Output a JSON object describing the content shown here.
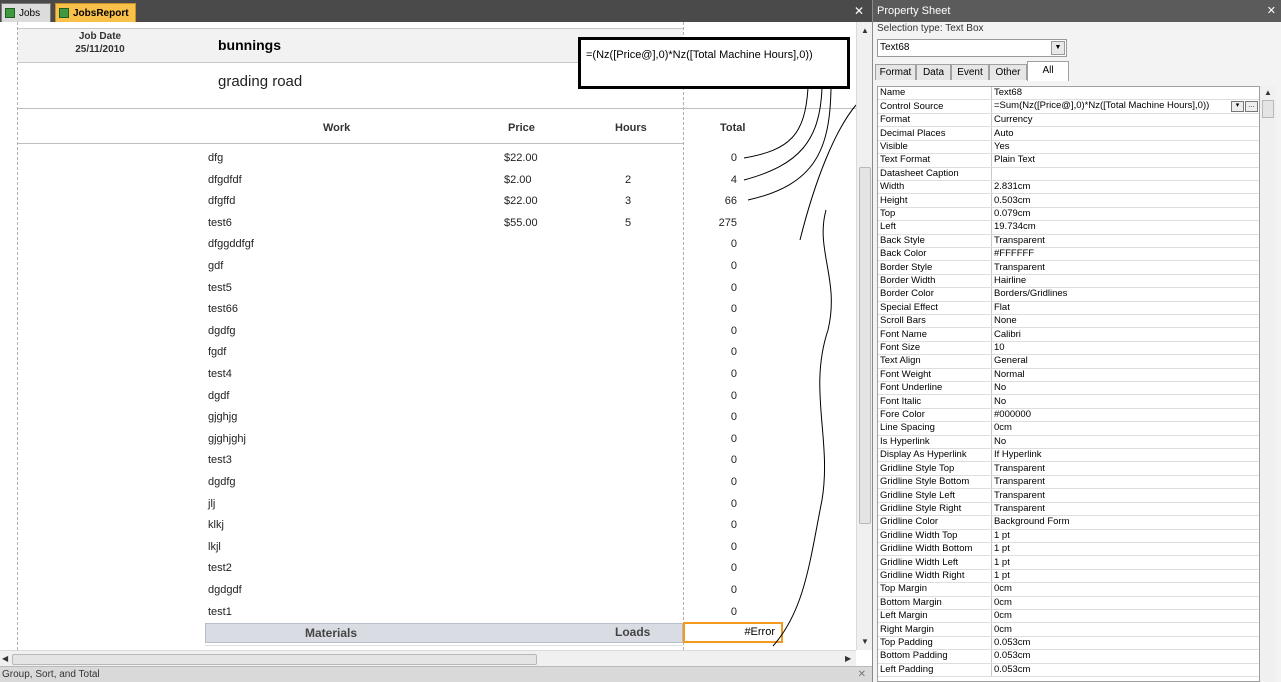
{
  "tabs": {
    "jobs": "Jobs",
    "jobsreport": "JobsReport"
  },
  "report": {
    "job_date_label": "Job Date",
    "job_date_value": "25/11/2010",
    "customer": "bunnings",
    "job_name": "grading road",
    "formula_callout": "=(Nz([Price@],0)*Nz([Total Machine Hours],0))",
    "columns": {
      "work": "Work",
      "price": "Price",
      "hours": "Hours",
      "total": "Total"
    },
    "rows": [
      {
        "work": "dfg",
        "price": "$22.00",
        "hours": "",
        "total": "0"
      },
      {
        "work": "dfgdfdf",
        "price": "$2.00",
        "hours": "2",
        "total": "4"
      },
      {
        "work": "dfgffd",
        "price": "$22.00",
        "hours": "3",
        "total": "66"
      },
      {
        "work": "test6",
        "price": "$55.00",
        "hours": "5",
        "total": "275"
      },
      {
        "work": "dfggddfgf",
        "price": "",
        "hours": "",
        "total": "0"
      },
      {
        "work": "gdf",
        "price": "",
        "hours": "",
        "total": "0"
      },
      {
        "work": "test5",
        "price": "",
        "hours": "",
        "total": "0"
      },
      {
        "work": "test66",
        "price": "",
        "hours": "",
        "total": "0"
      },
      {
        "work": "dgdfg",
        "price": "",
        "hours": "",
        "total": "0"
      },
      {
        "work": "fgdf",
        "price": "",
        "hours": "",
        "total": "0"
      },
      {
        "work": "test4",
        "price": "",
        "hours": "",
        "total": "0"
      },
      {
        "work": "dgdf",
        "price": "",
        "hours": "",
        "total": "0"
      },
      {
        "work": "gjghjg",
        "price": "",
        "hours": "",
        "total": "0"
      },
      {
        "work": "gjghjghj",
        "price": "",
        "hours": "",
        "total": "0"
      },
      {
        "work": "test3",
        "price": "",
        "hours": "",
        "total": "0"
      },
      {
        "work": "dgdfg",
        "price": "",
        "hours": "",
        "total": "0"
      },
      {
        "work": "jlj",
        "price": "",
        "hours": "",
        "total": "0"
      },
      {
        "work": "klkj",
        "price": "",
        "hours": "",
        "total": "0"
      },
      {
        "work": "lkjl",
        "price": "",
        "hours": "",
        "total": "0"
      },
      {
        "work": "test2",
        "price": "",
        "hours": "",
        "total": "0"
      },
      {
        "work": "dgdgdf",
        "price": "",
        "hours": "",
        "total": "0"
      },
      {
        "work": "test1",
        "price": "",
        "hours": "",
        "total": "0"
      }
    ],
    "materials_label": "Materials",
    "loads_label": "Loads",
    "error_value": "#Error"
  },
  "bottom_bar": {
    "label": "Group, Sort, and Total"
  },
  "property_sheet": {
    "title": "Property Sheet",
    "selection_type": "Selection type:  Text Box",
    "selected_control": "Text68",
    "tabs": [
      "Format",
      "Data",
      "Event",
      "Other",
      "All"
    ],
    "active_tab": "All",
    "properties": [
      {
        "name": "Name",
        "value": "Text68"
      },
      {
        "name": "Control Source",
        "value": "=Sum(Nz([Price@],0)*Nz([Total Machine Hours],0))"
      },
      {
        "name": "Format",
        "value": "Currency"
      },
      {
        "name": "Decimal Places",
        "value": "Auto"
      },
      {
        "name": "Visible",
        "value": "Yes"
      },
      {
        "name": "Text Format",
        "value": "Plain Text"
      },
      {
        "name": "Datasheet Caption",
        "value": ""
      },
      {
        "name": "Width",
        "value": "2.831cm"
      },
      {
        "name": "Height",
        "value": "0.503cm"
      },
      {
        "name": "Top",
        "value": "0.079cm"
      },
      {
        "name": "Left",
        "value": "19.734cm"
      },
      {
        "name": "Back Style",
        "value": "Transparent"
      },
      {
        "name": "Back Color",
        "value": "#FFFFFF"
      },
      {
        "name": "Border Style",
        "value": "Transparent"
      },
      {
        "name": "Border Width",
        "value": "Hairline"
      },
      {
        "name": "Border Color",
        "value": "Borders/Gridlines"
      },
      {
        "name": "Special Effect",
        "value": "Flat"
      },
      {
        "name": "Scroll Bars",
        "value": "None"
      },
      {
        "name": "Font Name",
        "value": "Calibri"
      },
      {
        "name": "Font Size",
        "value": "10"
      },
      {
        "name": "Text Align",
        "value": "General"
      },
      {
        "name": "Font Weight",
        "value": "Normal"
      },
      {
        "name": "Font Underline",
        "value": "No"
      },
      {
        "name": "Font Italic",
        "value": "No"
      },
      {
        "name": "Fore Color",
        "value": "#000000"
      },
      {
        "name": "Line Spacing",
        "value": "0cm"
      },
      {
        "name": "Is Hyperlink",
        "value": "No"
      },
      {
        "name": "Display As Hyperlink",
        "value": "If Hyperlink"
      },
      {
        "name": "Gridline Style Top",
        "value": "Transparent"
      },
      {
        "name": "Gridline Style Bottom",
        "value": "Transparent"
      },
      {
        "name": "Gridline Style Left",
        "value": "Transparent"
      },
      {
        "name": "Gridline Style Right",
        "value": "Transparent"
      },
      {
        "name": "Gridline Color",
        "value": "Background Form"
      },
      {
        "name": "Gridline Width Top",
        "value": "1 pt"
      },
      {
        "name": "Gridline Width Bottom",
        "value": "1 pt"
      },
      {
        "name": "Gridline Width Left",
        "value": "1 pt"
      },
      {
        "name": "Gridline Width Right",
        "value": "1 pt"
      },
      {
        "name": "Top Margin",
        "value": "0cm"
      },
      {
        "name": "Bottom Margin",
        "value": "0cm"
      },
      {
        "name": "Left Margin",
        "value": "0cm"
      },
      {
        "name": "Right Margin",
        "value": "0cm"
      },
      {
        "name": "Top Padding",
        "value": "0.053cm"
      },
      {
        "name": "Bottom Padding",
        "value": "0.053cm"
      },
      {
        "name": "Left Padding",
        "value": "0.053cm"
      }
    ]
  },
  "colors": {
    "active_tab": "#f9c04a",
    "error_border": "#f39a1e",
    "title_bar": "#5b5b5b"
  }
}
